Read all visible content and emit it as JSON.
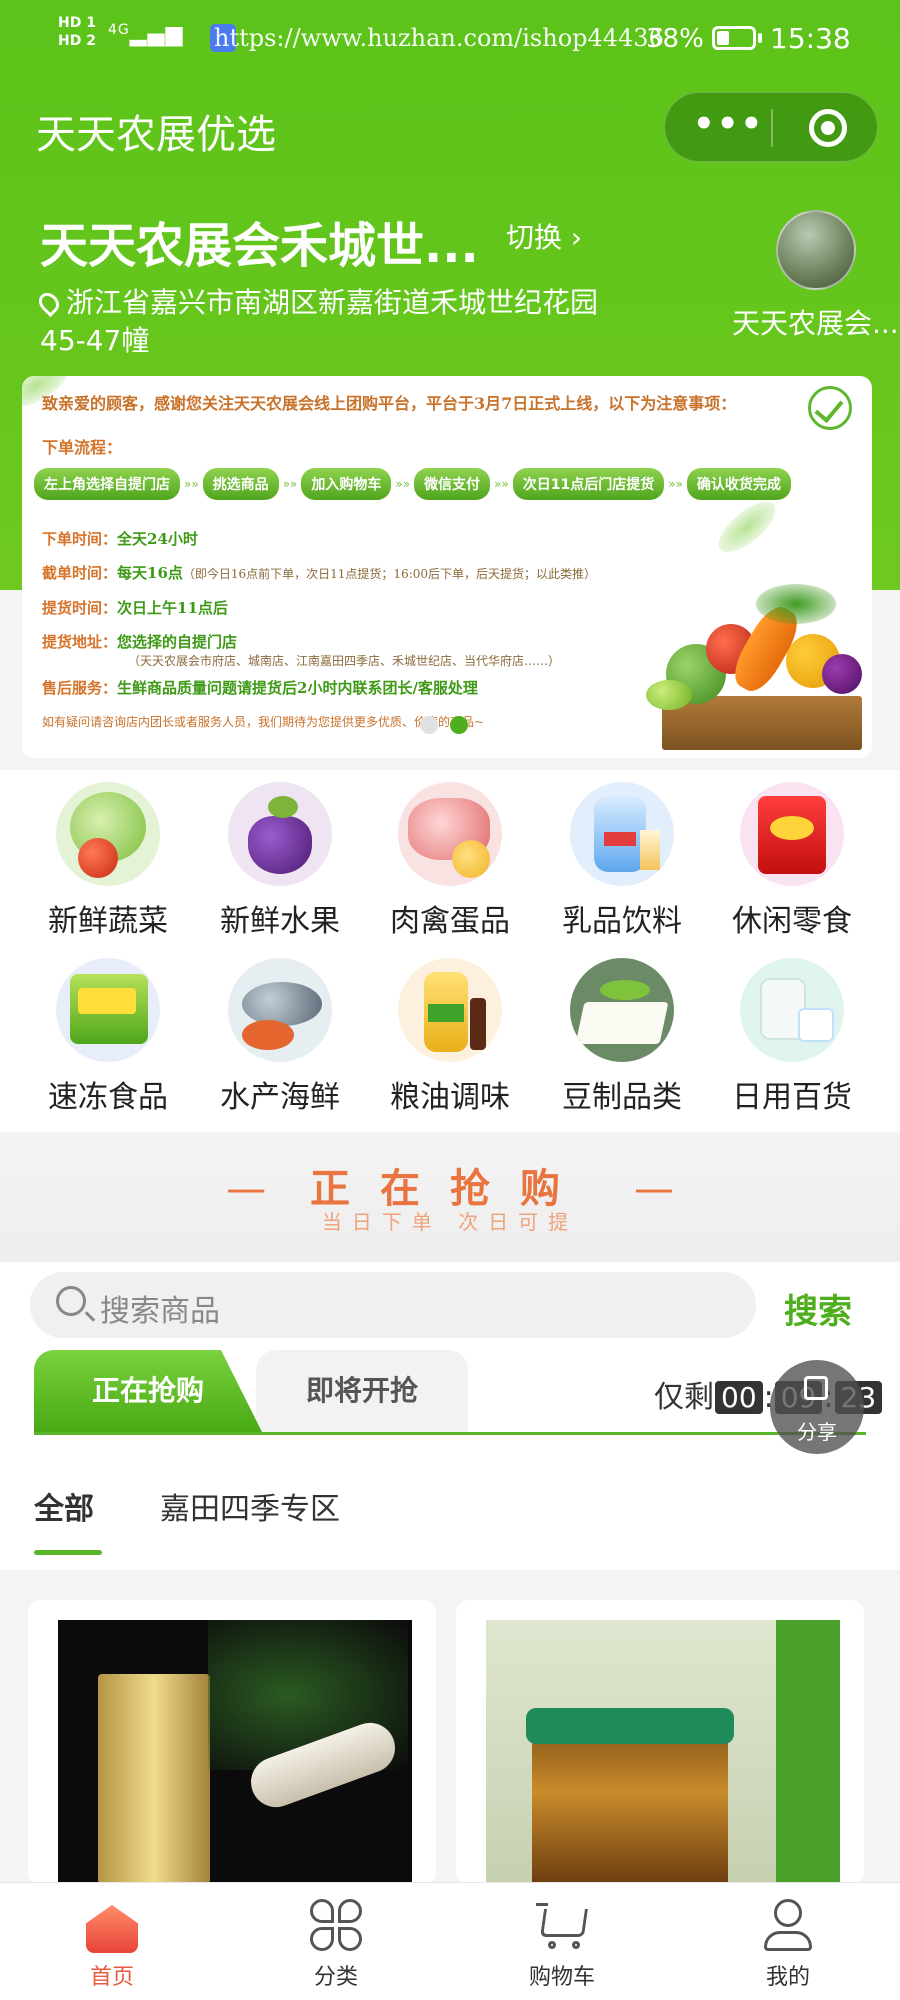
{
  "status_bar": {
    "network_1": "HD 1",
    "network_2": "HD 2",
    "signal": "4G",
    "url": "https://www.huzhan.com/ishop44436",
    "battery": "38%",
    "time": "15:38"
  },
  "header": {
    "title": "天天农展优选",
    "store_name": "天天农展会禾城世...",
    "switch_label": "切换",
    "address": "浙江省嘉兴市南湖区新嘉街道禾城世纪花园45-47幢",
    "store_avatar_name": "天天农展会..."
  },
  "banner": {
    "greeting": "致亲爱的顾客，感谢您关注天天农展会线上团购平台，平台于3月7日正式上线，以下为注意事项：",
    "flow_label": "下单流程：",
    "steps": [
      "左上角选择自提门店",
      "挑选商品",
      "加入购物车",
      "微信支付",
      "次日11点后门店提货",
      "确认收货完成"
    ],
    "rows": [
      {
        "label": "下单时间：",
        "value": "全天24小时",
        "note": ""
      },
      {
        "label": "截单时间：",
        "value": "每天16点",
        "note": "（即今日16点前下单，次日11点提货；16:00后下单，后天提货；以此类推）"
      },
      {
        "label": "提货时间：",
        "value": "次日上午11点后",
        "note": ""
      },
      {
        "label": "提货地址：",
        "value": "您选择的自提门店",
        "note": ""
      }
    ],
    "address_note": "（天天农展会市府店、城南店、江南嘉田四季店、禾城世纪店、当代华府店……）",
    "service_label": "售后服务：",
    "service_value": "生鲜商品质量问题请提货后2小时内联系团长/客服处理",
    "footer": "如有疑问请咨询店内团长或者服务人员，我们期待为您提供更多优质、价廉的商品~"
  },
  "categories": [
    {
      "label": "新鲜蔬菜",
      "icon": "vegetable-icon"
    },
    {
      "label": "新鲜水果",
      "icon": "fruit-icon"
    },
    {
      "label": "肉禽蛋品",
      "icon": "meat-icon"
    },
    {
      "label": "乳品饮料",
      "icon": "drink-icon"
    },
    {
      "label": "休闲零食",
      "icon": "snack-icon"
    },
    {
      "label": "速冻食品",
      "icon": "frozen-food-icon"
    },
    {
      "label": "水产海鲜",
      "icon": "seafood-icon"
    },
    {
      "label": "粮油调味",
      "icon": "oil-icon"
    },
    {
      "label": "豆制品类",
      "icon": "tofu-icon"
    },
    {
      "label": "日用百货",
      "icon": "daily-goods-icon"
    }
  ],
  "flash_sale": {
    "title_chars": [
      "正",
      "在",
      "抢",
      "购"
    ],
    "subtitle": "当日下单  次日可提"
  },
  "search": {
    "placeholder": "搜索商品",
    "button": "搜索"
  },
  "tabs": {
    "now": "正在抢购",
    "soon": "即将开抢"
  },
  "countdown": {
    "prefix": "仅剩",
    "hours": "00",
    "minutes": "09",
    "seconds": "23"
  },
  "share_label": "分享",
  "filters": {
    "all": "全部",
    "zone": "嘉田四季专区"
  },
  "products": [
    {
      "image": "shihu-liquor"
    },
    {
      "image": "xinfeng-ginger-jar"
    }
  ],
  "tabbar": [
    {
      "label": "首页",
      "icon": "home-icon",
      "active": true
    },
    {
      "label": "分类",
      "icon": "category-icon",
      "active": false
    },
    {
      "label": "购物车",
      "icon": "cart-icon",
      "active": false
    },
    {
      "label": "我的",
      "icon": "profile-icon",
      "active": false
    }
  ],
  "colors": {
    "brand_green": "#5cc31a",
    "accent_orange": "#e9743f",
    "active_tab_red": "#e85a3c"
  }
}
